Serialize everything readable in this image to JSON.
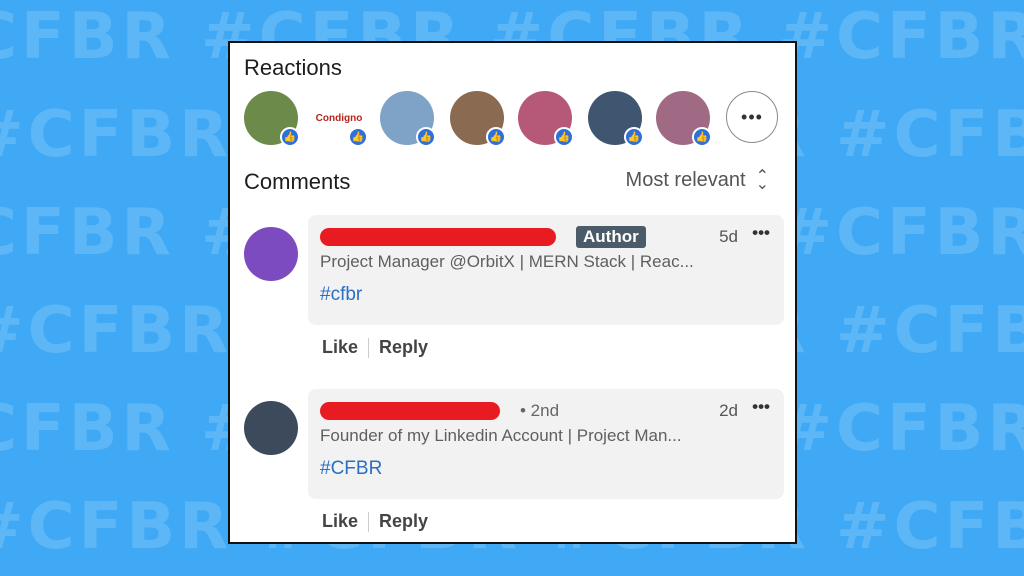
{
  "background": {
    "color": "#3fa9f5",
    "rows": [
      "CFBR #CFBR #CFBR #CFBR #CFBR",
      "#CFBR #CFBR #CFBR #CFBR #CFBR",
      "CFBR #CFBR #CFBR #CFBR #CFBR",
      "#CFBR #CFBR #CFBR #CFBR #CFBR",
      "CFBR #CFBR #CFBR #CFBR #CFBR",
      "#CFBR #CFBR #CFBR #CFBR #CFBR"
    ]
  },
  "reactions": {
    "title": "Reactions",
    "avatars": [
      {
        "kind": "photo",
        "color": "#6c8b4a"
      },
      {
        "kind": "logo",
        "label": "Condigno",
        "color": "#b3261e"
      },
      {
        "kind": "photo",
        "color": "#7fa2c7"
      },
      {
        "kind": "photo",
        "color": "#8a6b52"
      },
      {
        "kind": "photo",
        "color": "#b65878"
      },
      {
        "kind": "photo",
        "color": "#3f5570"
      },
      {
        "kind": "photo",
        "color": "#a06a84"
      }
    ],
    "more_label": "•••"
  },
  "comments": {
    "title": "Comments",
    "sort_label": "Most relevant",
    "items": [
      {
        "avatar_color": "#7c4bbf",
        "badge": "Author",
        "degree": "",
        "time": "5d",
        "headline": "Project Manager @OrbitX | MERN Stack | Reac...",
        "text": "#cfbr",
        "like": "Like",
        "reply": "Reply"
      },
      {
        "avatar_color": "#3c4a5c",
        "badge": "",
        "degree": "• 2nd",
        "time": "2d",
        "headline": "Founder of my Linkedin Account | Project Man...",
        "text": "#CFBR",
        "like": "Like",
        "reply": "Reply"
      }
    ]
  },
  "colors": {
    "like_badge": "#2f6fd8",
    "link": "#2a6fc4",
    "redaction": "#e81b23"
  }
}
